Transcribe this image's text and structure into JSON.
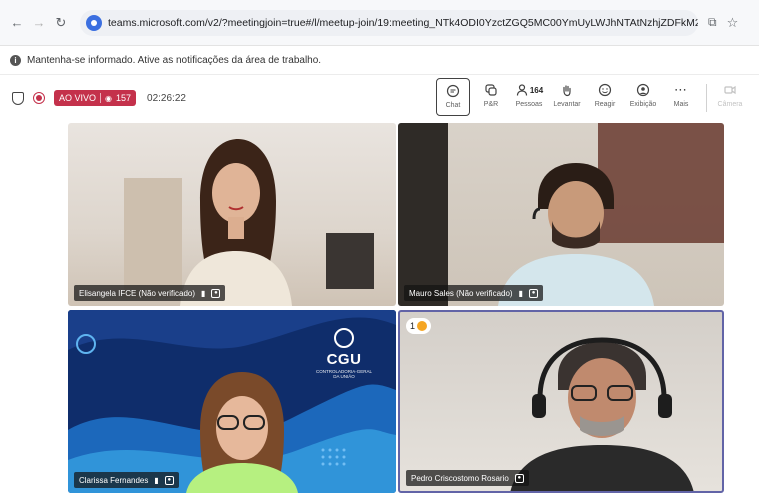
{
  "browser": {
    "url": "teams.microsoft.com/v2/?meetingjoin=true#/l/meetup-join/19:meeting_NTk4ODI0YzctZGQ5MC00YmUyLWJhNTAtNzhjZDFkM2ZiNDA4..."
  },
  "notice": {
    "text": "Mantenha-se informado. Ative as notificações da área de trabalho."
  },
  "toolbar": {
    "live_label": "AO VIVO",
    "viewers": "157",
    "timer": "02:26:22",
    "actions": [
      {
        "label": "Chat"
      },
      {
        "label": "P&R"
      },
      {
        "label": "Pessoas",
        "count": "164"
      },
      {
        "label": "Levantar"
      },
      {
        "label": "Reagir"
      },
      {
        "label": "Exibição"
      },
      {
        "label": "Mais"
      },
      {
        "label": "Câmera"
      }
    ]
  },
  "tiles": [
    {
      "name": "Elisangela IFCE (Não verificado)"
    },
    {
      "name": "Mauro Sales (Não verificado)"
    },
    {
      "name": "Clarissa Fernandes",
      "logo_text": "CGU",
      "logo_sub": "CONTROLADORIA-GERAL DA UNIÃO"
    },
    {
      "name": "Pedro Criscostomo Rosario",
      "raised_hand_count": "1"
    }
  ],
  "colors": {
    "live": "#c4314b",
    "speaker_border": "#6264a7",
    "cgu_bg": "#0f2d6b"
  }
}
